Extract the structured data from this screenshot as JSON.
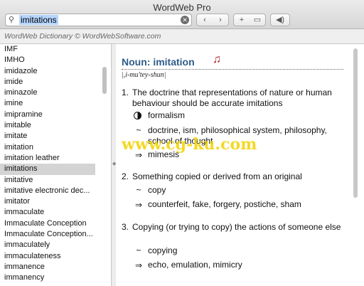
{
  "window": {
    "title": "WordWeb Pro"
  },
  "search": {
    "value": "imitations"
  },
  "toolbar": {
    "back": "‹",
    "forward": "›",
    "add": "+",
    "book": "▭",
    "speaker": "◀)"
  },
  "credit": "WordWeb Dictionary © WordWebSoftware.com",
  "word_list": [
    "IMF",
    "IMHO",
    "imidazole",
    "imide",
    "iminazole",
    "imine",
    "imipramine",
    "imitable",
    "imitate",
    "imitation",
    "imitation leather",
    "imitations",
    "imitative",
    "imitative electronic dec...",
    "imitator",
    "immaculate",
    "Immaculate Conception",
    "Immaculate Conception...",
    "immaculately",
    "immaculateness",
    "immanence",
    "immanency"
  ],
  "selected_word": "imitations",
  "entry": {
    "pos": "Noun: imitation",
    "pronunciation": "|,i-mu'tey-shun|",
    "senses": [
      {
        "num": "1.",
        "definition": "The doctrine that representations of nature or human behaviour should be accurate imitations",
        "category": "formalism",
        "similar": "doctrine, ism, philosophical system, philosophy, school of thought",
        "derived": "mimesis"
      },
      {
        "num": "2.",
        "definition": "Something copied or derived from an original",
        "similar": "copy",
        "derived": "counterfeit, fake, forgery, postiche, sham"
      },
      {
        "num": "3.",
        "definition": "Copying (or trying to copy) the actions of someone else",
        "similar": "copying",
        "derived": "echo, emulation, mimicry"
      }
    ]
  },
  "symbols": {
    "similar": "~",
    "derived": "⇒"
  },
  "watermark": "www.cg-ku.com",
  "colors": {
    "pos_heading": "#2f5c8a",
    "audio_note": "#b0161b",
    "selection": "#d4d4d4"
  }
}
